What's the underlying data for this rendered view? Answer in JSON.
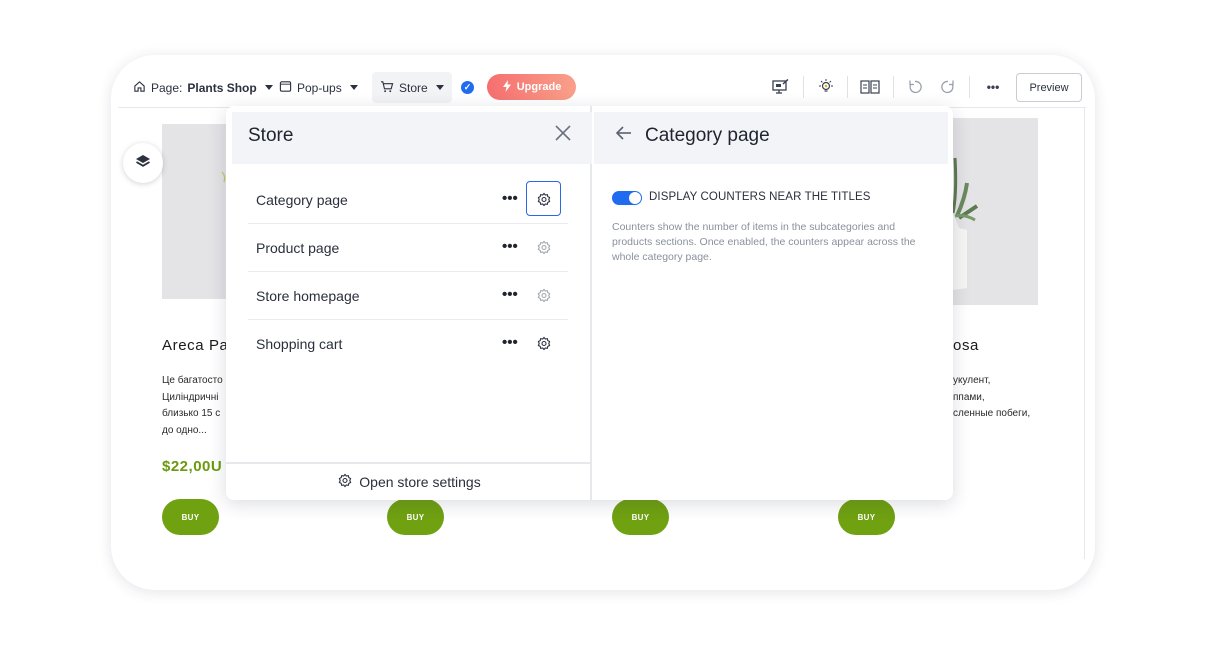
{
  "toolbar": {
    "page_prefix": "Page:",
    "page_name": "Plants Shop",
    "popups_label": "Pop-ups",
    "store_label": "Store",
    "upgrade_label": "Upgrade",
    "preview_label": "Preview",
    "icons": [
      "home-icon",
      "popup-window-icon",
      "cart-icon",
      "check-badge-icon",
      "lightning-icon",
      "monitor-edit-icon",
      "lightbulb-icon",
      "book-icon",
      "undo-icon",
      "redo-icon",
      "more-icon"
    ]
  },
  "background_page": {
    "products": [
      {
        "title_visible": "Areca Pa",
        "desc_lines": [
          "Це багатосто",
          "Циліндричні",
          "близько 15 с",
          "до одно..."
        ],
        "price_visible": "$22,00U",
        "buy_label": "BUY"
      },
      {
        "buy_label": "BUY"
      },
      {
        "buy_label": "BUY"
      },
      {
        "title_visible": "osa",
        "desc_lines": [
          "укулент,",
          "ппами,",
          "сленные побеги,"
        ],
        "buy_label": "BUY"
      }
    ],
    "colors": {
      "accent_green": "#70a111",
      "image_placeholder": "#e4e3e6"
    }
  },
  "store_panel": {
    "title": "Store",
    "items": [
      {
        "label": "Category page",
        "active": true
      },
      {
        "label": "Product page",
        "active": false
      },
      {
        "label": "Store homepage",
        "active": false
      },
      {
        "label": "Shopping cart",
        "active": false
      }
    ],
    "more_glyph": "•••",
    "footer_label": "Open store settings"
  },
  "detail_panel": {
    "title": "Category page",
    "toggle_label": "DISPLAY COUNTERS NEAR THE TITLES",
    "toggle_on": true,
    "helper_text": "Counters show the number of items in the subcategories and products sections. Once enabled, the counters appear across the whole category page.",
    "accent_color": "#1f6cf0"
  }
}
